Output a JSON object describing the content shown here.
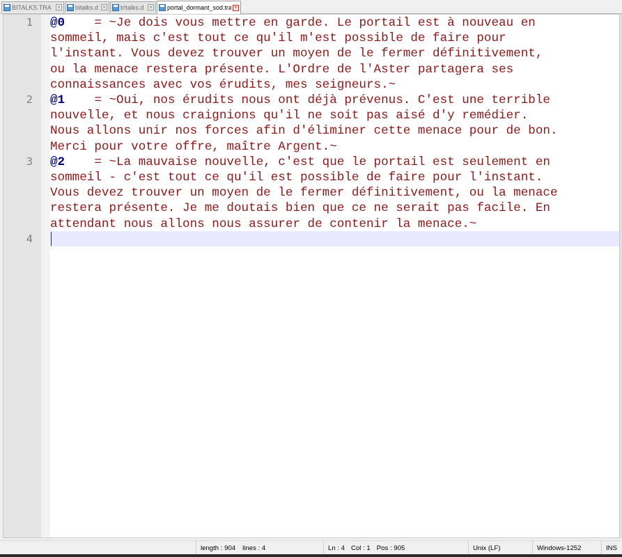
{
  "tabs": [
    {
      "label": "BITALKS.TRA",
      "active": false
    },
    {
      "label": "bitalks.d",
      "active": false
    },
    {
      "label": "b!talks.d",
      "active": false
    },
    {
      "label": "portal_dormant_sod.tra",
      "active": true
    }
  ],
  "editor": {
    "line_numbers": [
      "1",
      "2",
      "3",
      "4"
    ],
    "lines": [
      {
        "key": "@0",
        "text": "    = ~Je dois vous mettre en garde. Le portail est à nouveau en"
      },
      {
        "key": "",
        "text": "sommeil, mais c'est tout ce qu'il m'est possible de faire pour"
      },
      {
        "key": "",
        "text": "l'instant. Vous devez trouver un moyen de le fermer définitivement,"
      },
      {
        "key": "",
        "text": "ou la menace restera présente. L'Ordre de l'Aster partagera ses"
      },
      {
        "key": "",
        "text": "connaissances avec vos érudits, mes seigneurs.~"
      },
      {
        "key": "@1",
        "text": "    = ~Oui, nos érudits nous ont déjà prévenus. C'est une terrible"
      },
      {
        "key": "",
        "text": "nouvelle, et nous craignions qu'il ne soit pas aisé d'y remédier."
      },
      {
        "key": "",
        "text": "Nous allons unir nos forces afin d'éliminer cette menace pour de bon."
      },
      {
        "key": "",
        "text": "Merci pour votre offre, maître Argent.~"
      },
      {
        "key": "@2",
        "text": "    = ~La mauvaise nouvelle, c'est que le portail est seulement en"
      },
      {
        "key": "",
        "text": "sommeil - c'est tout ce qu'il est possible de faire pour l'instant."
      },
      {
        "key": "",
        "text": "Vous devez trouver un moyen de le fermer définitivement, ou la menace"
      },
      {
        "key": "",
        "text": "restera présente. Je me doutais bien que ce ne serait pas facile. En"
      },
      {
        "key": "",
        "text": "attendant nous allons nous assurer de contenir la menace.~"
      },
      {
        "key": "",
        "text": ""
      }
    ]
  },
  "status": {
    "length": "length : 904",
    "lines": "lines : 4",
    "ln": "Ln : 4",
    "col": "Col : 1",
    "pos": "Pos : 905",
    "eol": "Unix (LF)",
    "encoding": "Windows-1252",
    "mode": "INS"
  },
  "colors": {
    "text": "#8b1a1a",
    "key": "#000080",
    "current_line": "#e8e8ff",
    "caret": "#8000a0",
    "gutter": "#e4e4e4"
  }
}
